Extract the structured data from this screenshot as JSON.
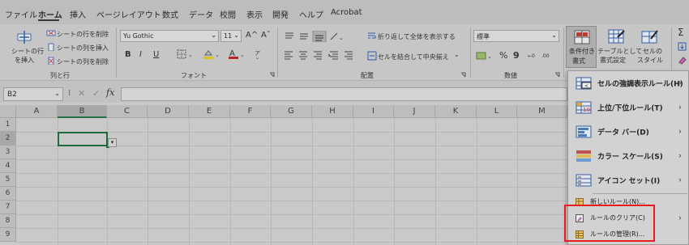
{
  "menubar": {
    "tabs": [
      "ファイル",
      "ホーム",
      "挿入",
      "ページレイアウト",
      "数式",
      "データ",
      "校閲",
      "表示",
      "開発",
      "ヘルプ",
      "Acrobat"
    ],
    "active": "ホーム"
  },
  "ribbon": {
    "cells_group": {
      "insert_sheet_row": "シートの行",
      "insert_sheet_row2": "を挿入",
      "delete_row": "シートの行を削除",
      "insert_col": "シートの列を挿入",
      "delete_col": "シートの列を削除",
      "label": "列と行"
    },
    "font_group": {
      "font_name": "Yu Gothic",
      "font_size": "11",
      "grow": "A^",
      "shrink": "Aˇ",
      "bold": "B",
      "italic": "I",
      "underline": "U",
      "label": "フォント"
    },
    "align_group": {
      "wrap": "折り返して全体を表示する",
      "merge": "セルを結合して中央揃え",
      "label": "配置"
    },
    "number_group": {
      "format": "標準",
      "percent": "%",
      "comma": "9",
      "label": "数値"
    },
    "styles_group": {
      "conditional_1": "条件付き",
      "conditional_2": "書式",
      "table_1": "テーブルとして",
      "table_2": "書式設定",
      "cell_1": "セルの",
      "cell_2": "スタイル"
    },
    "sum_icon": "Σ"
  },
  "formula": {
    "namebox": "B2",
    "fx": "fx"
  },
  "columns": [
    "A",
    "B",
    "C",
    "D",
    "E",
    "F",
    "G",
    "H",
    "I",
    "J",
    "K",
    "L",
    "M"
  ],
  "rows": [
    "1",
    "2",
    "3",
    "4",
    "5",
    "6",
    "7",
    "8",
    "9"
  ],
  "dropdown": {
    "items": [
      {
        "label": "セルの強調表示ルール(H)",
        "icon": "highlight-rules-icon",
        "arrow": "›"
      },
      {
        "label": "上位/下位ルール(T)",
        "icon": "top-bottom-rules-icon",
        "arrow": "›"
      },
      {
        "label": "データ バー(D)",
        "icon": "data-bars-icon",
        "arrow": "›"
      },
      {
        "label": "カラー スケール(S)",
        "icon": "color-scales-icon",
        "arrow": "›"
      },
      {
        "label": "アイコン セット(I)",
        "icon": "icon-sets-icon",
        "arrow": "›"
      }
    ],
    "new_rule": "新しいルール(N)...",
    "clear_rules": "ルールのクリア(C)",
    "clear_arrow": "›",
    "manage_rules": "ルールの管理(R)..."
  }
}
